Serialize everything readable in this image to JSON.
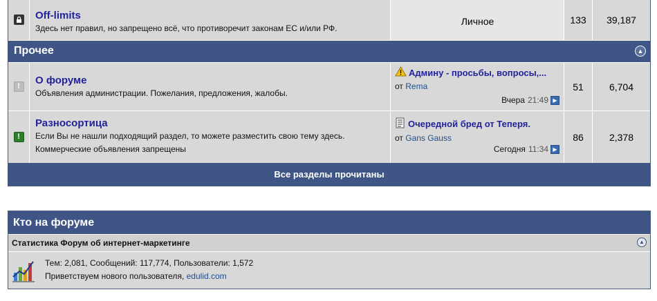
{
  "forums": {
    "offlimits": {
      "title": "Off-limits",
      "description": "Здесь нет правил, но запрещено всё, что противоречит законам ЕС и/или РФ.",
      "last_post": "Личное",
      "threads": "133",
      "posts": "39,187"
    },
    "category": {
      "title": "Прочее"
    },
    "about": {
      "title": "О форуме",
      "description": "Объявления администрации. Пожелания, предложения, жалобы.",
      "last_thread": "Админу - просьбы, вопросы,...",
      "by_prefix": "от",
      "by_user": "Rema",
      "when_day": "Вчера",
      "when_time": "21:49",
      "threads": "51",
      "posts": "6,704"
    },
    "misc": {
      "title": "Разносортица",
      "description_line1": "Если Вы не нашли подходящий раздел, то можете разместить свою тему здесь.",
      "description_line2": "Коммерческие объявления запрещены",
      "last_thread": "Очередной бред от Теперя.",
      "by_prefix": "от",
      "by_user": "Gans Gauss",
      "when_day": "Сегодня",
      "when_time": "11:34",
      "threads": "86",
      "posts": "2,378"
    },
    "mark_read": "Все разделы прочитаны"
  },
  "online": {
    "title": "Кто на форуме",
    "stats_title": "Статистика Форум об интернет-маркетинге",
    "stats_line": "Тем: 2,081, Сообщений: 117,774, Пользователи: 1,572",
    "welcome_prefix": "Приветствуем нового пользователя,",
    "new_user": "edulid.com"
  },
  "colors": {
    "header_bg": "#3e5585",
    "link": "#22229c",
    "row_bg": "#d8d8d8"
  },
  "icons": [
    "lock-icon",
    "forum-old-icon",
    "forum-new-icon",
    "collapse-icon",
    "warning-icon",
    "document-icon",
    "go-to-post-icon",
    "stats-chart-icon"
  ]
}
